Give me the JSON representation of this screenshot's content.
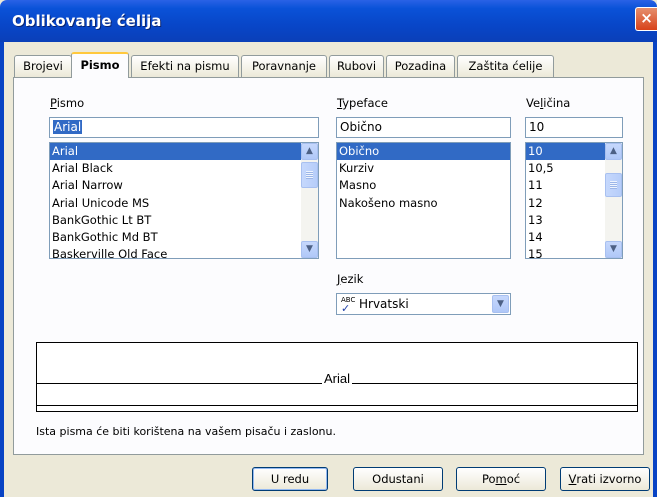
{
  "window": {
    "title": "Oblikovanje ćelija",
    "close_label": "×"
  },
  "tabs": [
    "Brojevi",
    "Pismo",
    "Efekti na pismu",
    "Poravnanje",
    "Rubovi",
    "Pozadina",
    "Zaštita ćelije"
  ],
  "active_tab": "Pismo",
  "font": {
    "label_hotkey": "P",
    "label_rest": "ismo",
    "value": "Arial",
    "options": [
      "Arial",
      "Arial Black",
      "Arial Narrow",
      "Arial Unicode MS",
      "BankGothic Lt BT",
      "BankGothic Md BT",
      "Baskerville Old Face"
    ],
    "selected": "Arial"
  },
  "typeface": {
    "label_hotkey": "T",
    "label_rest": "ypeface",
    "value": "Obično",
    "options": [
      "Obično",
      "Kurziv",
      "Masno",
      "Nakošeno masno"
    ],
    "selected": "Obično"
  },
  "size": {
    "label_pre": "Ve",
    "label_hotkey": "l",
    "label_rest": "ičina",
    "value": "10",
    "options": [
      "10",
      "10,5",
      "11",
      "12",
      "13",
      "14",
      "15"
    ],
    "selected": "10"
  },
  "language": {
    "label_hotkey": "J",
    "label_rest": "ezik",
    "value": "Hrvatski",
    "icon_text_top": "ABC",
    "icon_text_check": "✓"
  },
  "preview": {
    "text": "Arial"
  },
  "note": "Ista pisma će biti korištena na vašem pisaču i zaslonu.",
  "buttons": {
    "ok": "U redu",
    "cancel": "Odustani",
    "help_pre": "Po",
    "help_hotkey": "m",
    "help_rest": "oć",
    "reset_hotkey": "V",
    "reset_rest": "rati izvorno"
  },
  "colors": {
    "title_bar": "#0a52d8",
    "selection": "#316ac5",
    "active_tab_accent": "#ffc83c"
  }
}
